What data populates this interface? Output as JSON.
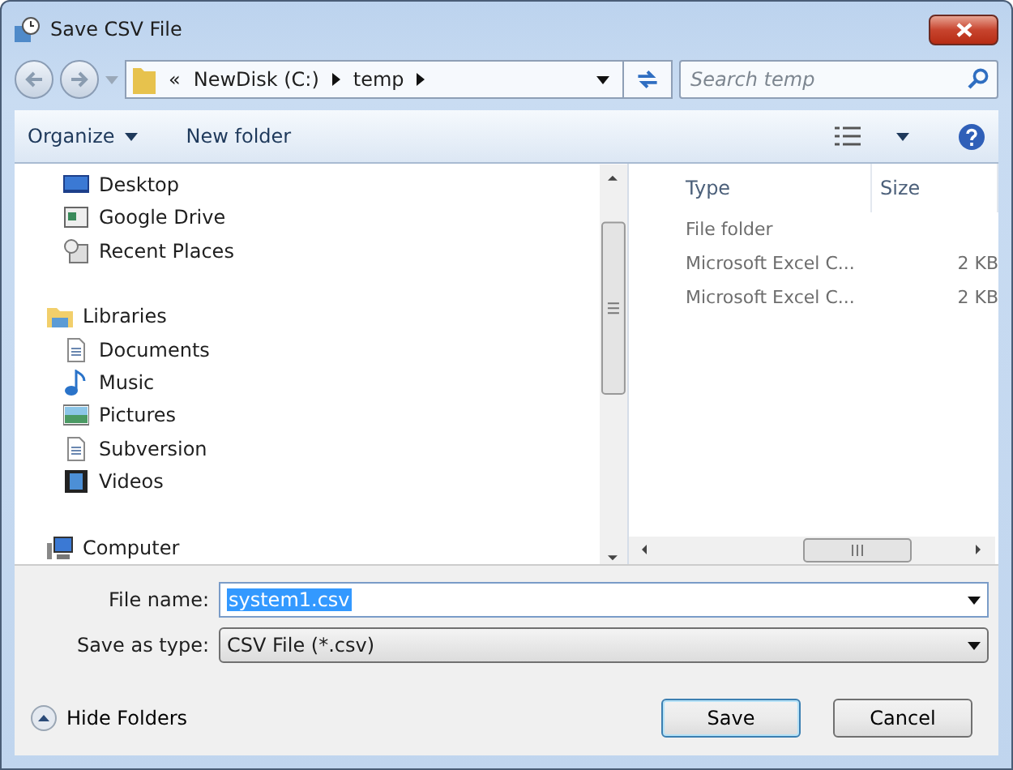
{
  "window": {
    "title": "Save CSV File"
  },
  "address": {
    "crumbs": [
      "«",
      "NewDisk (C:)",
      "temp"
    ],
    "search_placeholder": "Search temp"
  },
  "toolbar": {
    "organize": "Organize",
    "new_folder": "New folder"
  },
  "nav_groups": [
    {
      "children": [
        {
          "label": "Desktop",
          "kind": "desktop"
        },
        {
          "label": "Google Drive",
          "kind": "drive"
        },
        {
          "label": "Recent Places",
          "kind": "recent"
        }
      ]
    },
    {
      "label": "Libraries",
      "kind": "library",
      "children": [
        {
          "label": "Documents",
          "kind": "document"
        },
        {
          "label": "Music",
          "kind": "music"
        },
        {
          "label": "Pictures",
          "kind": "pictures"
        },
        {
          "label": "Subversion",
          "kind": "document"
        },
        {
          "label": "Videos",
          "kind": "videos"
        }
      ]
    },
    {
      "label": "Computer",
      "kind": "computer"
    }
  ],
  "files": {
    "columns": [
      "Type",
      "Size"
    ],
    "rows": [
      {
        "type": "File folder"
      },
      {
        "type": "Microsoft Excel C...",
        "size": "2 KB"
      },
      {
        "type": "Microsoft Excel C...",
        "size": "2 KB"
      }
    ]
  },
  "form": {
    "file_name_label": "File name:",
    "file_name": "system1.csv",
    "type_label": "Save as type:",
    "type": "CSV File (*.csv)"
  },
  "footer": {
    "hide_folders": "Hide Folders",
    "save": "Save",
    "cancel": "Cancel"
  }
}
